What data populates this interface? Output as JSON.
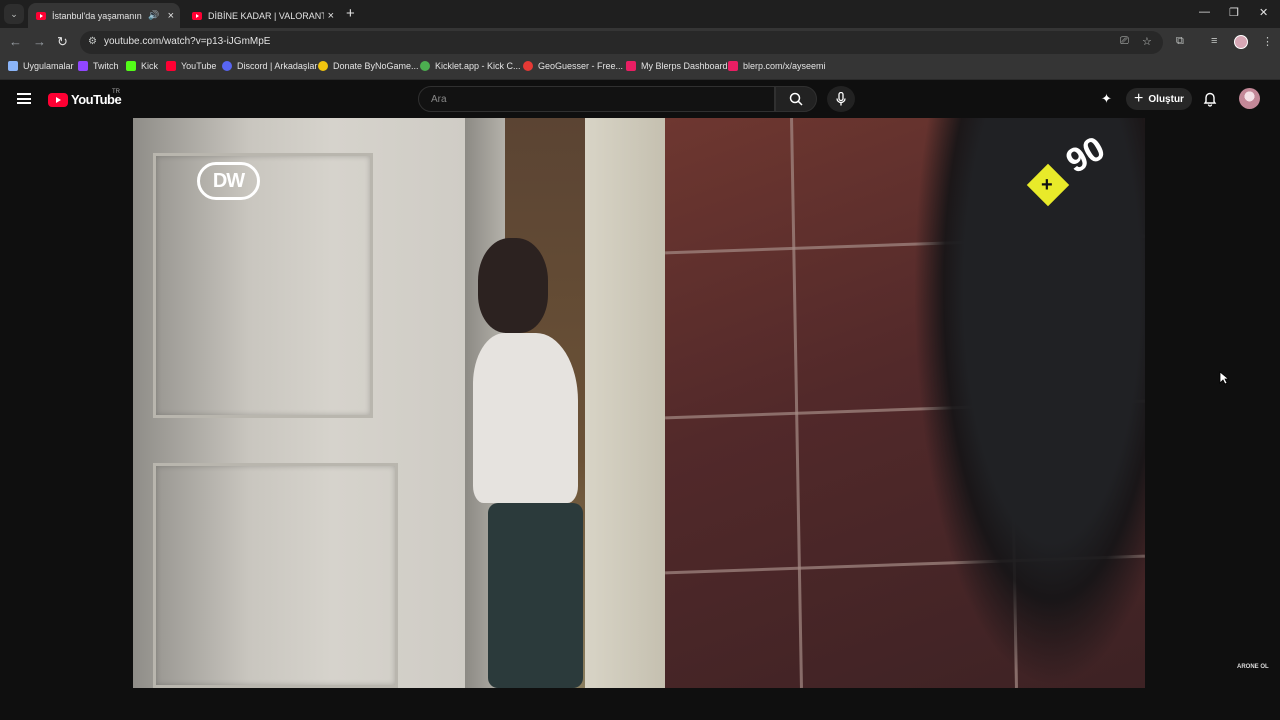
{
  "browser": {
    "tabs": [
      {
        "title": "İstanbul'da yaşamanın bed",
        "active": true,
        "audio": "🔊"
      },
      {
        "title": "DİBİNE KADAR | VALORANT ED",
        "active": false
      }
    ],
    "new_tab_label": "+",
    "url": "youtube.com/watch?v=p13-iJGmMpE",
    "bookmarks": [
      {
        "label": "Uygulamalar",
        "color": "#8ab4f8"
      },
      {
        "label": "Twitch",
        "color": "#9146ff"
      },
      {
        "label": "Kick",
        "color": "#53fc18"
      },
      {
        "label": "YouTube",
        "color": "#ff0033"
      },
      {
        "label": "Discord | Arkadaşlar",
        "color": "#5865f2"
      },
      {
        "label": "Donate ByNoGame...",
        "color": "#f1c40f"
      },
      {
        "label": "Kicklet.app - Kick C...",
        "color": "#4caf50"
      },
      {
        "label": "GeoGuesser - Free...",
        "color": "#e53935"
      },
      {
        "label": "My Blerps Dashboard",
        "color": "#e91e63"
      },
      {
        "label": "blerp.com/x/ayseemi",
        "color": "#e91e63"
      }
    ]
  },
  "youtube": {
    "logo_text": "YouTube",
    "region": "TR",
    "search_placeholder": "Ara",
    "create_label": "Oluştur"
  },
  "video": {
    "channel_logo": "DW",
    "badge_number": "90",
    "badge_plus": "+"
  },
  "overlay": {
    "corner_text": "ARONE OL"
  }
}
